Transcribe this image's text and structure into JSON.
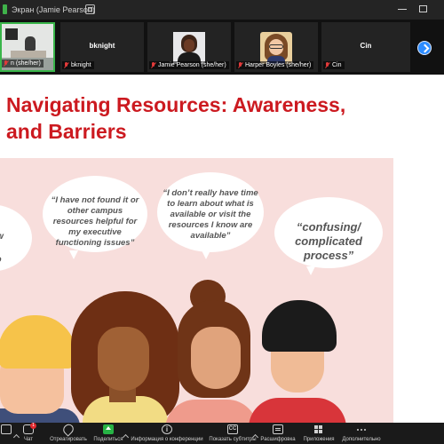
{
  "window": {
    "title": "Экран (Jamie Pearson)"
  },
  "participants": [
    {
      "id": "video",
      "label": "n (she/her)",
      "muted": true
    },
    {
      "id": "bknight",
      "label": "bknight",
      "center_name": "bknight",
      "muted": true
    },
    {
      "id": "jamie",
      "label": "Jamie Pearson (she/her)",
      "muted": true
    },
    {
      "id": "harper",
      "label": "Harper Boyles (she/her)",
      "muted": true
    },
    {
      "id": "cin",
      "label": "Cin",
      "center_name": "Cin",
      "muted": true
    }
  ],
  "slide": {
    "title_line1": "Navigating Resources: Awareness,",
    "title_line2": "and Barriers",
    "quotes": {
      "left_partial": [
        "ow",
        "at",
        "so"
      ],
      "q2": "“I have not found it or other campus resources helpful for my executive functioning issues”",
      "q3": "“I don’t really have time to learn about what is available or visit the resources I know are available”",
      "q4": "“confusing/ complicated process”"
    }
  },
  "toolbar": {
    "chat": "Чат",
    "chat_badge": "1",
    "react": "Отреагировать",
    "share": "Поделиться",
    "info": "Информация о конференции",
    "captions": "Показать субтитры",
    "transcript": "Расшифровка",
    "apps": "Приложения",
    "more": "Дополнительно"
  },
  "colors": {
    "accent": "#cc1a20",
    "share_green": "#27b345",
    "active_speaker": "#39b54a",
    "slide_bg": "#f8dedc"
  }
}
